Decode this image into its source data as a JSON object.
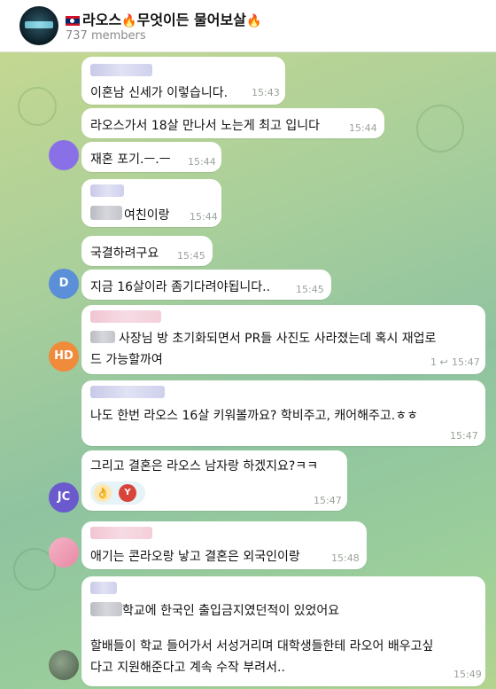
{
  "header": {
    "title": "라오스",
    "title_rest": "무엇이든 물어보살",
    "members": "737 members"
  },
  "messages": [
    {
      "text": "이혼남 신세가 이렇습니다.",
      "time": "15:43"
    },
    {
      "text": "라오스가서 18살 만나서 노는게 최고 입니다",
      "time": "15:44"
    },
    {
      "text": "재혼 포기.ㅡ.ㅡ",
      "time": "15:44"
    },
    {
      "text": "여친이랑",
      "time": "15:44"
    },
    {
      "text": "국결하려구요",
      "time": "15:45"
    },
    {
      "text": "지금 16살이라 좀기다려야됩니다..",
      "time": "15:45",
      "avatar": "D"
    },
    {
      "line1": "사장님 방 초기화되면서 PR들 사진도 사라졌는데 혹시 재업로",
      "line2": "드 가능할까여",
      "time": "15:47",
      "avatar": "HD",
      "reply_count": "1"
    },
    {
      "text": "나도 한번 라오스 16살 키워볼까요? 학비주고, 캐어해주고.ㅎㅎ",
      "time": "15:47"
    },
    {
      "text": "그리고 결혼은 라오스 남자랑 하겠지요?ㅋㅋ",
      "time": "15:47",
      "avatar": "JC",
      "reaction_avatar": "Y"
    },
    {
      "text": "애기는 콘라오랑 낳고 결혼은 외국인이랑",
      "time": "15:48"
    },
    {
      "line1": "학교에 한국인 출입금지였던적이 있었어요",
      "line2": "할배들이 학교 들어가서 서성거리며 대학생들한테 라오어 배우고싶",
      "line3": "다고 지원해준다고 계속 수작 부려서..",
      "time": "15:49"
    }
  ],
  "colors": {
    "accent_blue": "#5b8fd8",
    "avatar_hd": "#f08b3c",
    "avatar_jc": "#6a5acd",
    "time": "#9aa39a"
  }
}
